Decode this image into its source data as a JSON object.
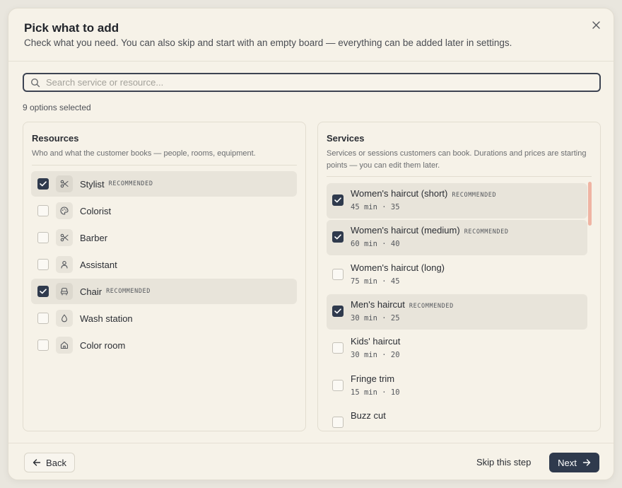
{
  "dialog": {
    "title": "Pick what to add",
    "subtitle": "Check what you need. You can also skip and start with an empty board — everything can be added later in settings."
  },
  "search": {
    "placeholder": "Search service or resource..."
  },
  "selected_count": "9 options selected",
  "resources": {
    "title": "Resources",
    "description": "Who and what the customer books — people, rooms, equipment.",
    "items": [
      {
        "label": "Stylist",
        "badge": "RECOMMENDED",
        "checked": true,
        "icon": "scissors-icon"
      },
      {
        "label": "Colorist",
        "badge": "",
        "checked": false,
        "icon": "palette-icon"
      },
      {
        "label": "Barber",
        "badge": "",
        "checked": false,
        "icon": "scissors-icon"
      },
      {
        "label": "Assistant",
        "badge": "",
        "checked": false,
        "icon": "person-icon"
      },
      {
        "label": "Chair",
        "badge": "RECOMMENDED",
        "checked": true,
        "icon": "chair-icon"
      },
      {
        "label": "Wash station",
        "badge": "",
        "checked": false,
        "icon": "droplet-icon"
      },
      {
        "label": "Color room",
        "badge": "",
        "checked": false,
        "icon": "home-icon"
      }
    ]
  },
  "services": {
    "title": "Services",
    "description": "Services or sessions customers can book. Durations and prices are starting points — you can edit them later.",
    "items": [
      {
        "label": "Women's haircut (short)",
        "badge": "RECOMMENDED",
        "meta": "45 min · 35",
        "checked": true
      },
      {
        "label": "Women's haircut (medium)",
        "badge": "RECOMMENDED",
        "meta": "60 min · 40",
        "checked": true
      },
      {
        "label": "Women's haircut (long)",
        "badge": "",
        "meta": "75 min · 45",
        "checked": false
      },
      {
        "label": "Men's haircut",
        "badge": "RECOMMENDED",
        "meta": "30 min · 25",
        "checked": true
      },
      {
        "label": "Kids' haircut",
        "badge": "",
        "meta": "30 min · 20",
        "checked": false
      },
      {
        "label": "Fringe trim",
        "badge": "",
        "meta": "15 min · 10",
        "checked": false
      },
      {
        "label": "Buzz cut",
        "badge": "",
        "meta": "",
        "checked": false
      }
    ]
  },
  "footer": {
    "back_label": "Back",
    "skip_label": "Skip this step",
    "next_label": "Next"
  },
  "colors": {
    "primary": "#2f3a4d",
    "background": "#f6f2e8",
    "selected_row": "#e8e4da",
    "scrollbar": "#efb4a3"
  }
}
